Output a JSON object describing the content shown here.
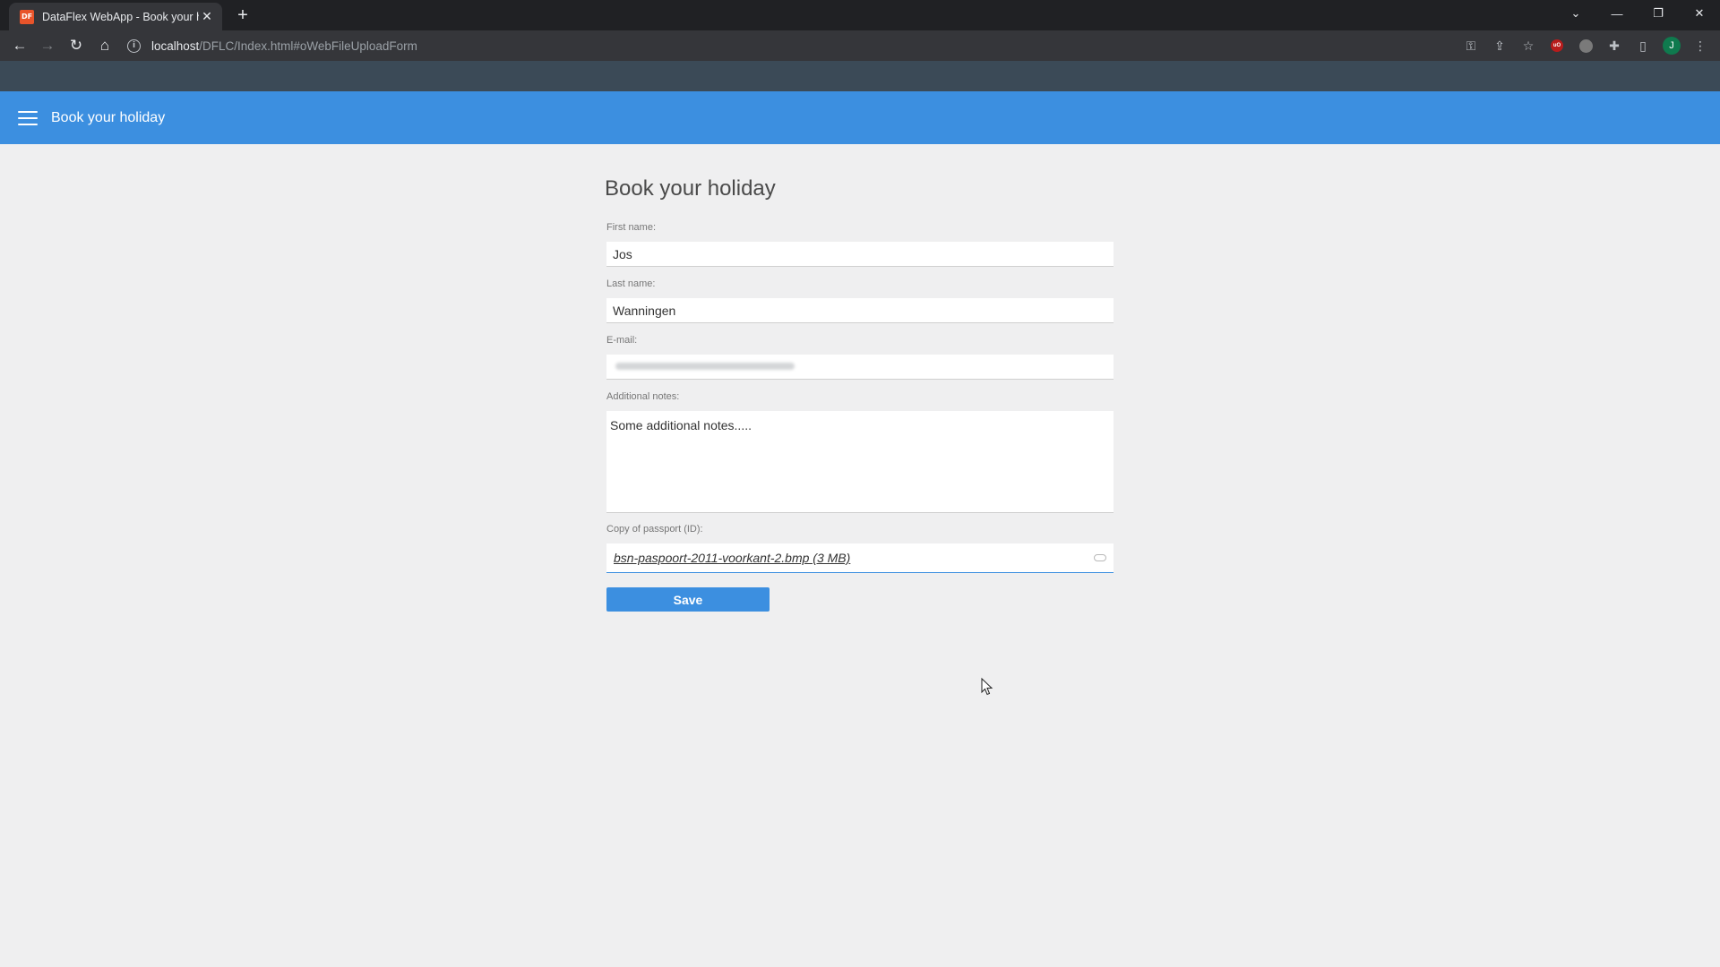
{
  "browser": {
    "tab_title": "DataFlex WebApp - Book your holiday",
    "favicon_text": "DF",
    "url_host": "localhost",
    "url_path": "/DFLC/Index.html#oWebFileUploadForm",
    "profile_initial": "J",
    "extension_text": "uO"
  },
  "app": {
    "header_title": "Book your holiday"
  },
  "form": {
    "title": "Book your holiday",
    "first_name": {
      "label": "First name:",
      "value": "Jos"
    },
    "last_name": {
      "label": "Last name:",
      "value": "Wanningen"
    },
    "email": {
      "label": "E-mail:"
    },
    "notes": {
      "label": "Additional notes:",
      "value": "Some additional notes....."
    },
    "passport": {
      "label": "Copy of passport (ID):",
      "file": "bsn-paspoort-2011-voorkant-2.bmp (3 MB)"
    },
    "save_label": "Save"
  },
  "theme": {
    "accent": "#3c8fe0",
    "background": "#efeff0"
  }
}
